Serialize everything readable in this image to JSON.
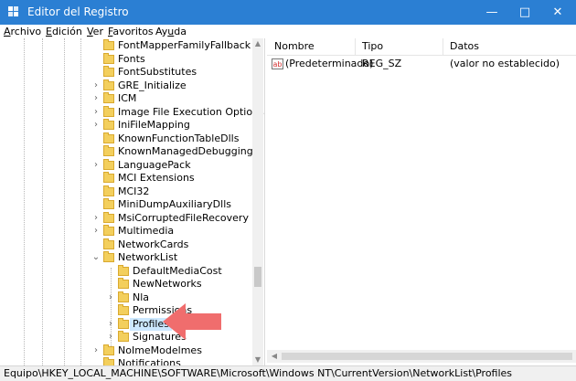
{
  "window": {
    "title": "Editor del Registro",
    "minimize_icon": "minimize",
    "maximize_icon": "maximize",
    "close_icon": "close"
  },
  "menu": [
    {
      "label": "Archivo",
      "mnemonic": "A"
    },
    {
      "label": "Edición",
      "mnemonic": "E"
    },
    {
      "label": "Ver",
      "mnemonic": "V"
    },
    {
      "label": "Favoritos",
      "mnemonic": "F"
    },
    {
      "label": "Ayuda",
      "mnemonic": "u"
    }
  ],
  "tree": {
    "items": [
      {
        "label": "FontMapperFamilyFallback",
        "level": 1,
        "expander": false
      },
      {
        "label": "Fonts",
        "level": 1,
        "expander": false
      },
      {
        "label": "FontSubstitutes",
        "level": 1,
        "expander": false
      },
      {
        "label": "GRE_Initialize",
        "level": 1,
        "expander": "collapsed"
      },
      {
        "label": "ICM",
        "level": 1,
        "expander": "collapsed"
      },
      {
        "label": "Image File Execution Options",
        "level": 1,
        "expander": "collapsed"
      },
      {
        "label": "IniFileMapping",
        "level": 1,
        "expander": "collapsed"
      },
      {
        "label": "KnownFunctionTableDlls",
        "level": 1,
        "expander": false
      },
      {
        "label": "KnownManagedDebuggingDlls",
        "level": 1,
        "expander": false
      },
      {
        "label": "LanguagePack",
        "level": 1,
        "expander": "collapsed"
      },
      {
        "label": "MCI Extensions",
        "level": 1,
        "expander": false
      },
      {
        "label": "MCI32",
        "level": 1,
        "expander": false
      },
      {
        "label": "MiniDumpAuxiliaryDlls",
        "level": 1,
        "expander": false
      },
      {
        "label": "MsiCorruptedFileRecovery",
        "level": 1,
        "expander": "collapsed"
      },
      {
        "label": "Multimedia",
        "level": 1,
        "expander": "collapsed"
      },
      {
        "label": "NetworkCards",
        "level": 1,
        "expander": false
      },
      {
        "label": "NetworkList",
        "level": 1,
        "expander": "expanded"
      },
      {
        "label": "DefaultMediaCost",
        "level": 2,
        "expander": false
      },
      {
        "label": "NewNetworks",
        "level": 2,
        "expander": false
      },
      {
        "label": "Nla",
        "level": 2,
        "expander": "collapsed"
      },
      {
        "label": "Permissions",
        "level": 2,
        "expander": false
      },
      {
        "label": "Profiles",
        "level": 2,
        "expander": "collapsed",
        "selected": true
      },
      {
        "label": "Signatures",
        "level": 2,
        "expander": "collapsed"
      },
      {
        "label": "NoImeModelmes",
        "level": 1,
        "expander": "collapsed"
      },
      {
        "label": "Notifications",
        "level": 1,
        "expander": false
      }
    ]
  },
  "values_pane": {
    "columns": [
      "Nombre",
      "Tipo",
      "Datos"
    ],
    "rows": [
      {
        "name": "(Predeterminado)",
        "type": "REG_SZ",
        "data": "(valor no establecido)",
        "icon": "ab"
      }
    ]
  },
  "status_bar": {
    "path": "Equipo\\HKEY_LOCAL_MACHINE\\SOFTWARE\\Microsoft\\Windows NT\\CurrentVersion\\NetworkList\\Profiles"
  },
  "colors": {
    "title_bar": "#2b7fd3",
    "selection": "#cce8ff",
    "folder": "#f3cf5d",
    "arrow": "#f06d6d"
  }
}
